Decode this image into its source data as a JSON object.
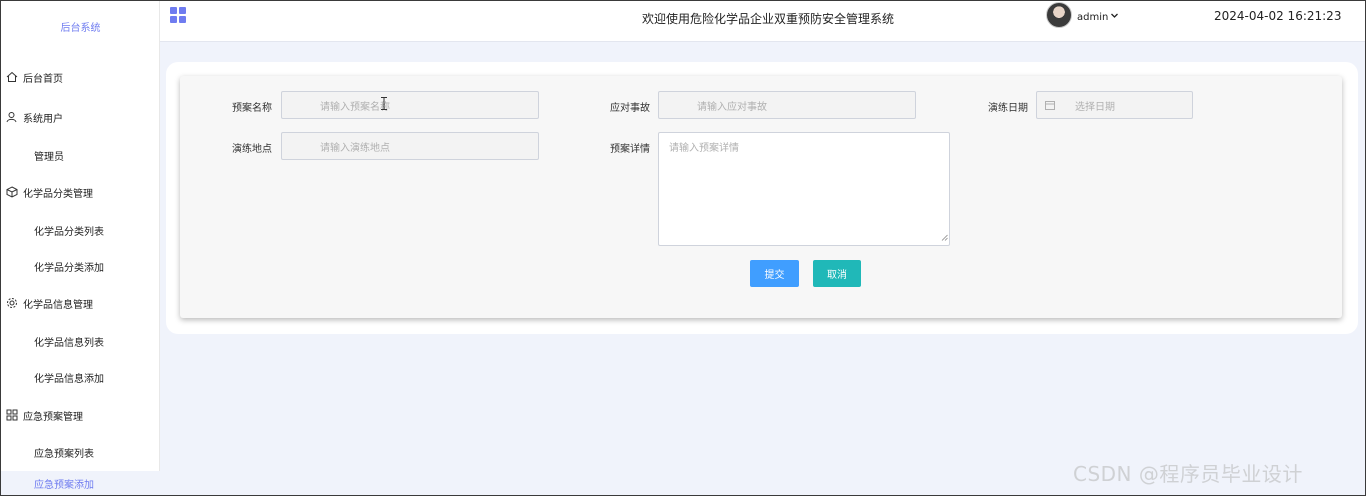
{
  "sidebar": {
    "title": "后台系统",
    "items": [
      {
        "label": "后台首页",
        "icon": "home-icon"
      },
      {
        "label": "系统用户",
        "icon": "user-icon"
      },
      {
        "label": "管理员"
      },
      {
        "label": "化学品分类管理",
        "icon": "box-icon"
      },
      {
        "label": "化学品分类列表"
      },
      {
        "label": "化学品分类添加"
      },
      {
        "label": "化学品信息管理",
        "icon": "gear-icon"
      },
      {
        "label": "化学品信息列表"
      },
      {
        "label": "化学品信息添加"
      },
      {
        "label": "应急预案管理",
        "icon": "grid-icon"
      },
      {
        "label": "应急预案列表"
      },
      {
        "label": "应急预案添加"
      }
    ]
  },
  "header": {
    "title": "欢迎使用危险化学品企业双重预防安全管理系统",
    "user": "admin",
    "datetime": "2024-04-02 16:21:23"
  },
  "form": {
    "plan_name_label": "预案名称",
    "plan_name_placeholder": "请输入预案名称",
    "incident_label": "应对事故",
    "incident_placeholder": "请输入应对事故",
    "drill_date_label": "演练日期",
    "drill_date_placeholder": "选择日期",
    "drill_location_label": "演练地点",
    "drill_location_placeholder": "请输入演练地点",
    "detail_label": "预案详情",
    "detail_placeholder": "请输入预案详情",
    "submit_label": "提交",
    "cancel_label": "取消"
  },
  "colors": {
    "accent": "#6f7cf0",
    "submit": "#409eff",
    "cancel": "#20b8b8"
  },
  "watermark": "CSDN @程序员毕业设计"
}
